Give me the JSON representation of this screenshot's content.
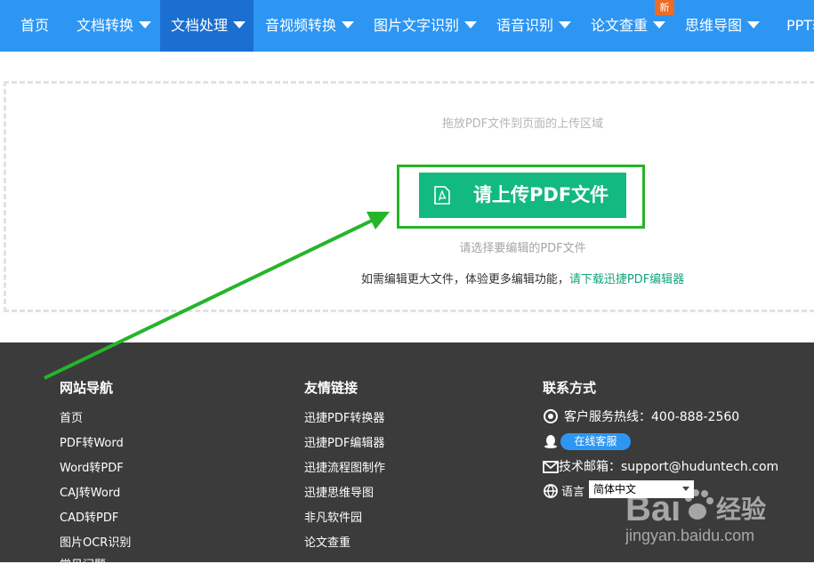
{
  "nav": {
    "items": [
      {
        "label": "首页"
      },
      {
        "label": "文档转换"
      },
      {
        "label": "文档处理"
      },
      {
        "label": "音视频转换"
      },
      {
        "label": "图片文字识别"
      },
      {
        "label": "语音识别"
      },
      {
        "label": "论文查重"
      },
      {
        "label": "思维导图"
      },
      {
        "label": "PPT转"
      }
    ],
    "new_badge": "新",
    "active_index": 2
  },
  "upload": {
    "drop_hint": "拖放PDF文件到页面的上传区域",
    "button_label": "请上传PDF文件",
    "select_hint": "请选择要编辑的PDF文件",
    "more_text": "如需编辑更大文件，体验更多编辑功能，",
    "download_link": "请下载迅捷PDF编辑器"
  },
  "footer": {
    "nav_title": "网站导航",
    "nav_links": [
      "首页",
      "PDF转Word",
      "Word转PDF",
      "CAJ转Word",
      "CAD转PDF",
      "图片OCR识别",
      "常见问题"
    ],
    "friend_title": "友情链接",
    "friend_links": [
      "迅捷PDF转换器",
      "迅捷PDF编辑器",
      "迅捷流程图制作",
      "迅捷思维导图",
      "非凡软件园",
      "论文查重"
    ],
    "contact_title": "联系方式",
    "hotline": "客户服务热线：400-888-2560",
    "online_service": "在线客服",
    "email": "技术邮箱：support@huduntech.com",
    "language_label": "语言",
    "language_value": "简体中文"
  },
  "watermark": {
    "brand": "Bai",
    "brand_cn": "经验",
    "url": "jingyan.baidu.com"
  },
  "colors": {
    "nav_bg": "#2d96f3",
    "nav_active": "#1a6fd1",
    "upload_green": "#12b981",
    "highlight_green": "#26b42a",
    "footer_bg": "#3b3b3b"
  }
}
